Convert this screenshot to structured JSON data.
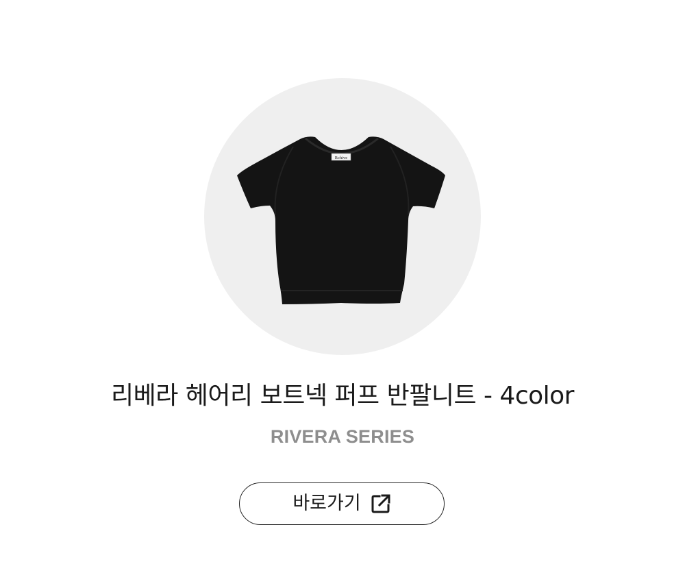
{
  "product": {
    "image_alt": "black short sleeve knit crop top",
    "tag_text": "Rchive",
    "title": "리베라 헤어리 보트넥 퍼프 반팔니트 - 4color",
    "series": "RIVERA SERIES"
  },
  "cta": {
    "label": "바로가기",
    "icon": "external-link-icon"
  },
  "colors": {
    "circle_bg": "#efefef",
    "garment": "#141414",
    "series_text": "#8e8e8e",
    "title_text": "#1a1a1a",
    "button_border": "#222222"
  }
}
